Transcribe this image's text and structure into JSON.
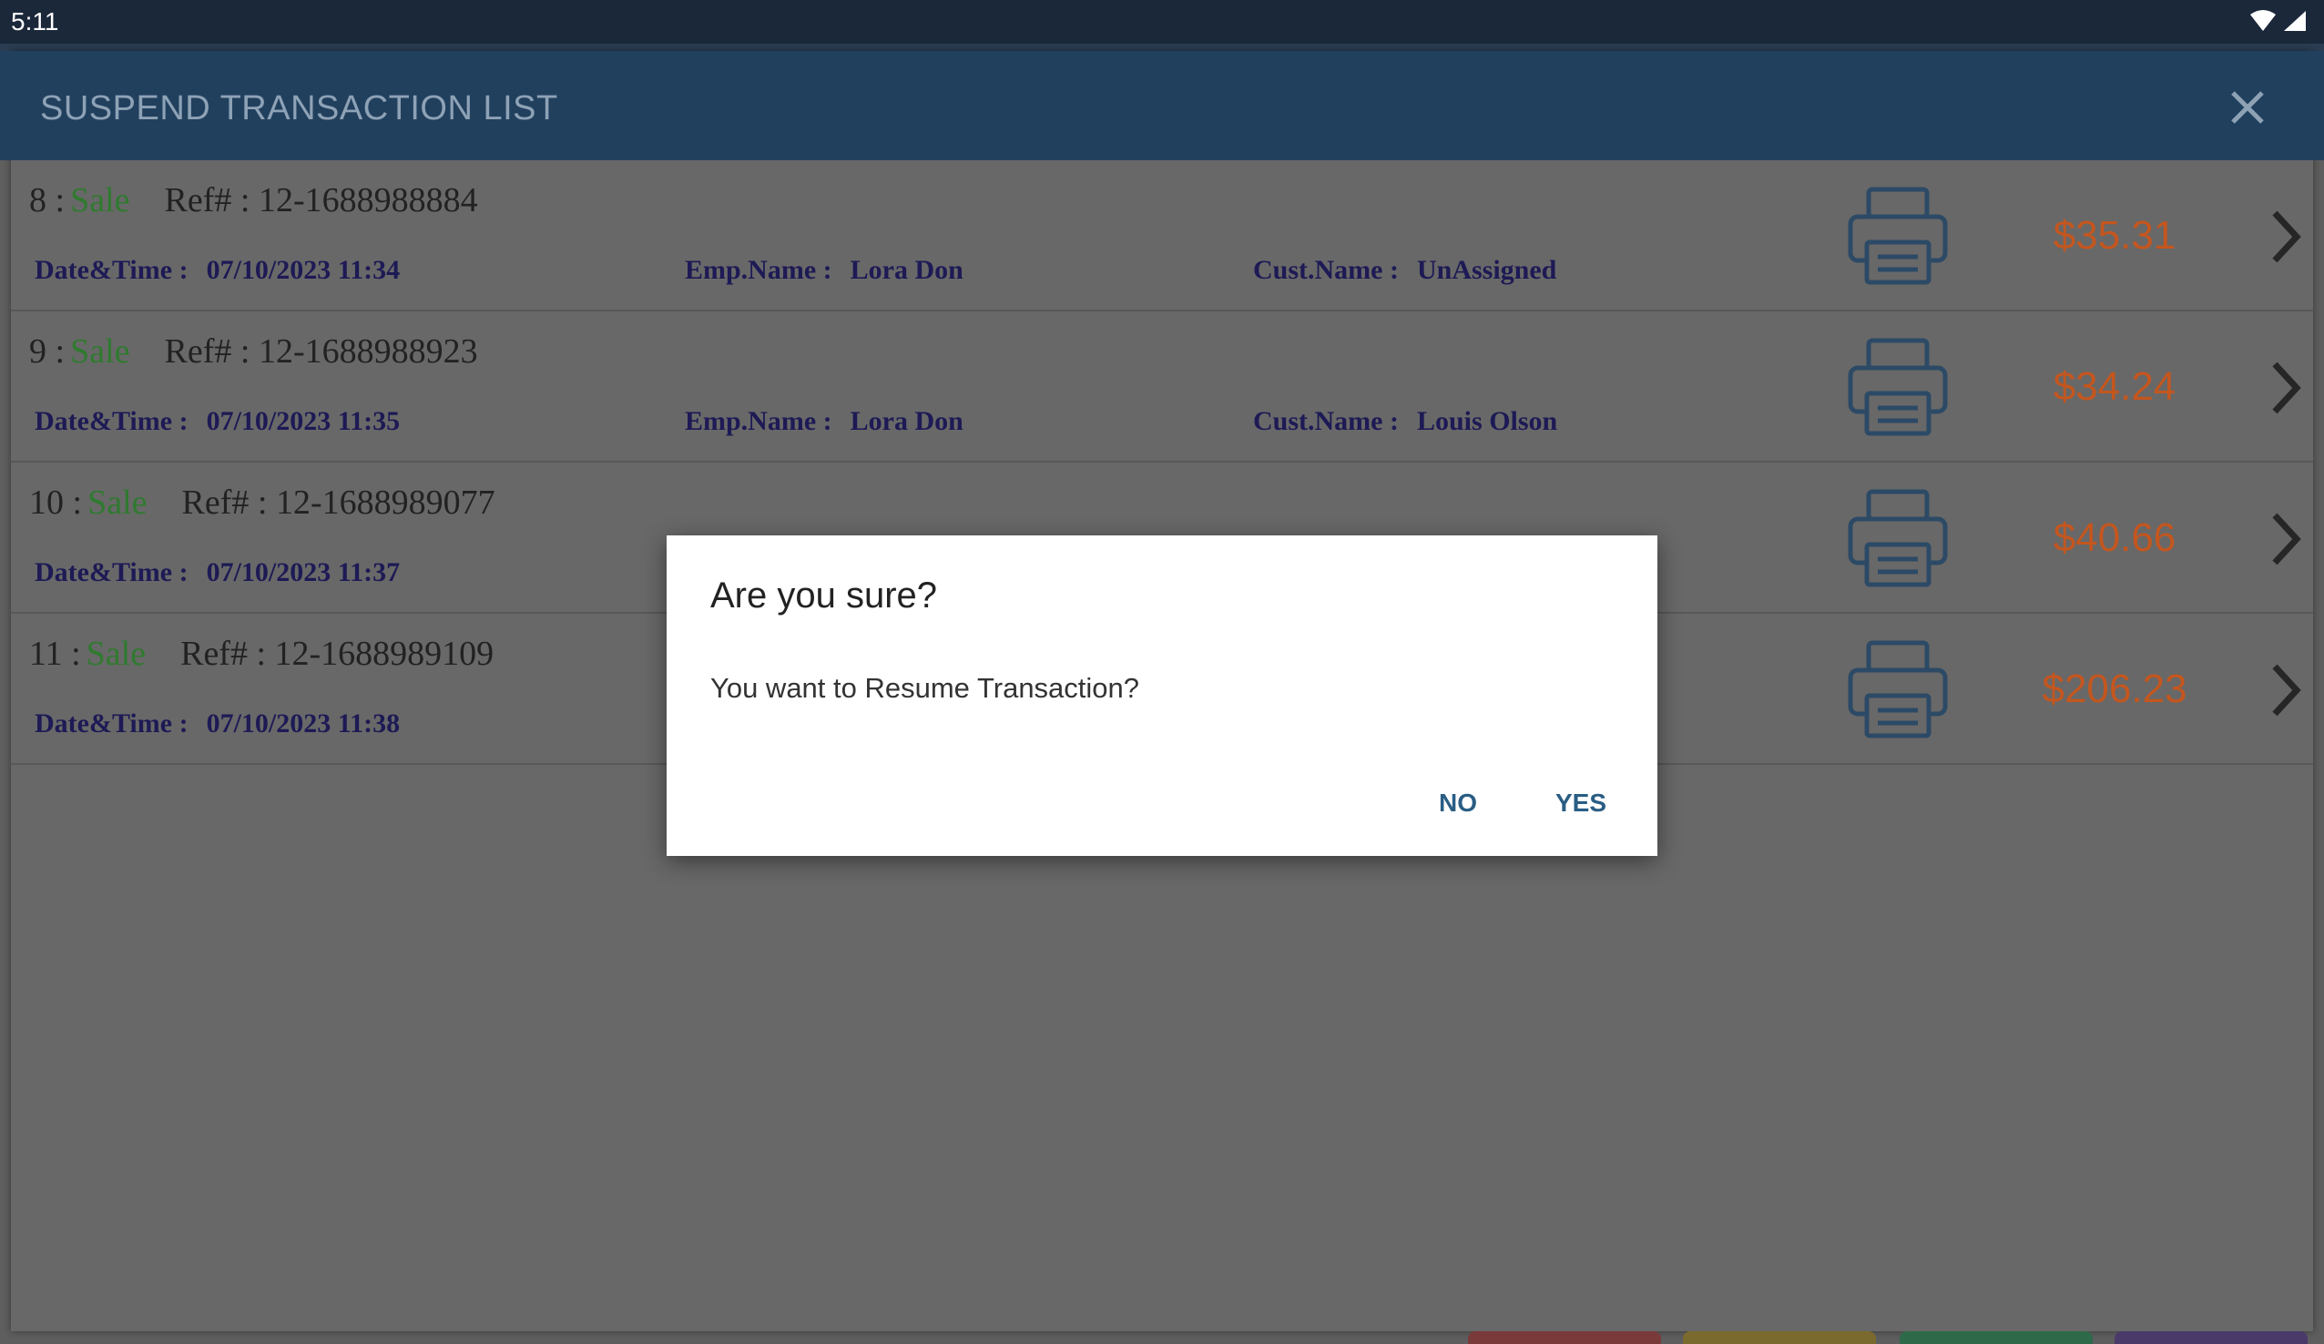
{
  "status_bar": {
    "time": "5:11",
    "icons": [
      "wifi-icon",
      "signal-icon"
    ]
  },
  "panel": {
    "title": "SUSPEND TRANSACTION LIST",
    "close_icon": "close-icon"
  },
  "labels": {
    "ref": "Ref# :",
    "datetime": "Date&Time :",
    "emp": "Emp.Name :",
    "cust": "Cust.Name :"
  },
  "transactions": [
    {
      "num": "8 :",
      "type": "Sale",
      "ref": "12-1688988884",
      "datetime": "07/10/2023 11:34",
      "emp": "Lora Don",
      "cust": "UnAssigned",
      "amount": "$35.31"
    },
    {
      "num": "9 :",
      "type": "Sale",
      "ref": "12-1688988923",
      "datetime": "07/10/2023 11:35",
      "emp": "Lora Don",
      "cust": "Louis Olson",
      "amount": "$34.24"
    },
    {
      "num": "10 :",
      "type": "Sale",
      "ref": "12-1688989077",
      "datetime": "07/10/2023 11:37",
      "emp": "",
      "cust": "",
      "amount": "$40.66"
    },
    {
      "num": "11 :",
      "type": "Sale",
      "ref": "12-1688989109",
      "datetime": "07/10/2023 11:38",
      "emp": "",
      "cust": "",
      "amount": "$206.23"
    }
  ],
  "dialog": {
    "title": "Are you sure?",
    "message": "You want to Resume Transaction?",
    "no_label": "NO",
    "yes_label": "YES"
  },
  "colors": {
    "header_bg": "#21405e",
    "sale_green": "#2f7a2f",
    "amount_orange": "#c4561e",
    "detail_navy": "#1d1a55",
    "dialog_button": "#2a5d84"
  }
}
